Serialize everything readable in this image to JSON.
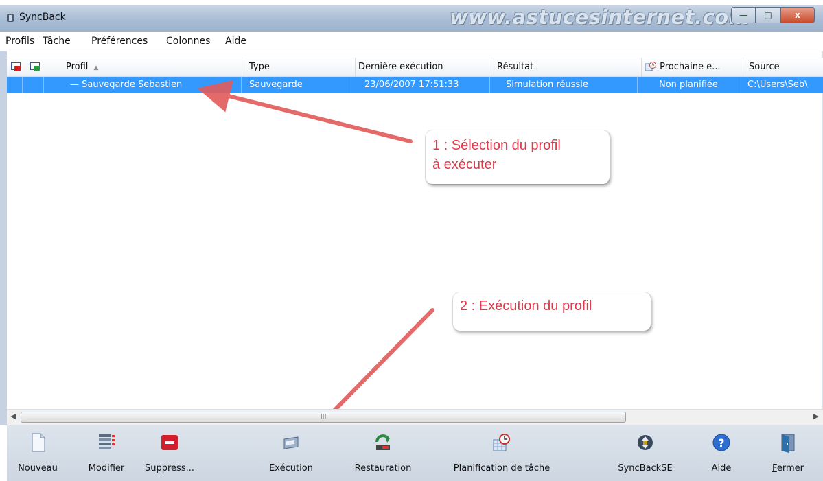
{
  "window": {
    "title": "SyncBack",
    "watermark": "www.astucesinternet.com",
    "min_glyph": "—",
    "max_glyph": "□",
    "close_glyph": "x"
  },
  "menu": [
    "Profils",
    "Tâche",
    "Préférences",
    "Colonnes",
    "Aide"
  ],
  "table": {
    "columns": [
      "Profil",
      "Type",
      "Dernière exécution",
      "Résultat",
      "Prochaine e...",
      "Source"
    ],
    "sort_indicator": "▲",
    "rows": [
      {
        "profile": "—  Sauvegarde Sebastien",
        "type": "Sauvegarde",
        "last_run": "23/06/2007 17:51:33",
        "result": "Simulation réussie",
        "next_run": "Non planifiée",
        "source": "C:\\Users\\Seb\\"
      }
    ]
  },
  "annotations": {
    "step1_line1": "1 : Sélection du profil",
    "step1_line2": "à exécuter",
    "step2": "2 : Exécution du profil"
  },
  "scrollbar": {
    "left_arrow": "◀",
    "right_arrow": "▶",
    "grip": "III"
  },
  "toolbar": {
    "nouveau": "Nouveau",
    "modifier": "Modifier",
    "suppress": "Suppress...",
    "execution": "Exécution",
    "restauration": "Restauration",
    "planification": "Planification de tâche",
    "syncbackse": "SyncBackSE",
    "aide": "Aide",
    "fermer_first": "F",
    "fermer_rest": "ermer"
  },
  "colors": {
    "selection": "#3399ff",
    "annotation": "#e0384a",
    "arrow": "#e25a5a"
  }
}
